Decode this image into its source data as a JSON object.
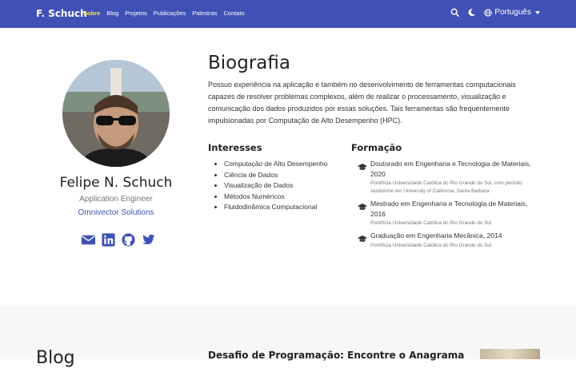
{
  "navbar": {
    "brand": "F. Schuch",
    "links": [
      "Sobre",
      "Blog",
      "Projetos",
      "Publicações",
      "Palestras",
      "Contato"
    ],
    "language": "Português",
    "accent": "#3f51b5",
    "active_color": "#ffeb3b"
  },
  "profile": {
    "name": "Felipe N. Schuch",
    "role": "Application Engineer",
    "organization": "Omnivector Solutions",
    "social_icons": [
      "email-icon",
      "linkedin-icon",
      "github-icon",
      "twitter-icon"
    ]
  },
  "biography": {
    "title": "Biografia",
    "text": "Possuo experiência na aplicação e também no desenvolvimento de ferramentas computacionais capazes de resolver problemas complexos, além de realizar o processamento, visualização e comunicação dos dados produzidos por essas soluções. Tais ferramentas são frequentemente impulsionadas por Computação de Alto Desempenho (HPC)."
  },
  "interests": {
    "title": "Interesses",
    "items": [
      "Computação de Alto Desempenho",
      "Ciência de Dados",
      "Visualização de Dados",
      "Métodos Numéricos",
      "Fluidodinâmica Computacional"
    ]
  },
  "education": {
    "title": "Formação",
    "items": [
      {
        "course": "Doutorado em Engenharia e Tecnologia de Materiais, 2020",
        "institution": "Pontifícia Universidade Católica do Rio Grande do Sul, com período sanduíche em University of California, Santa Barbara"
      },
      {
        "course": "Mestrado em Engenharia e Tecnologia de Materiais, 2016",
        "institution": "Pontifícia Universidade Católica do Rio Grande do Sul"
      },
      {
        "course": "Graduação em Engenharia Mecânica, 2014",
        "institution": "Pontifícia Universidade Católica do Rio Grande do Sul"
      }
    ]
  },
  "blog": {
    "title": "Blog",
    "post_title": "Desafio de Programação: Encontre o Anagrama"
  }
}
